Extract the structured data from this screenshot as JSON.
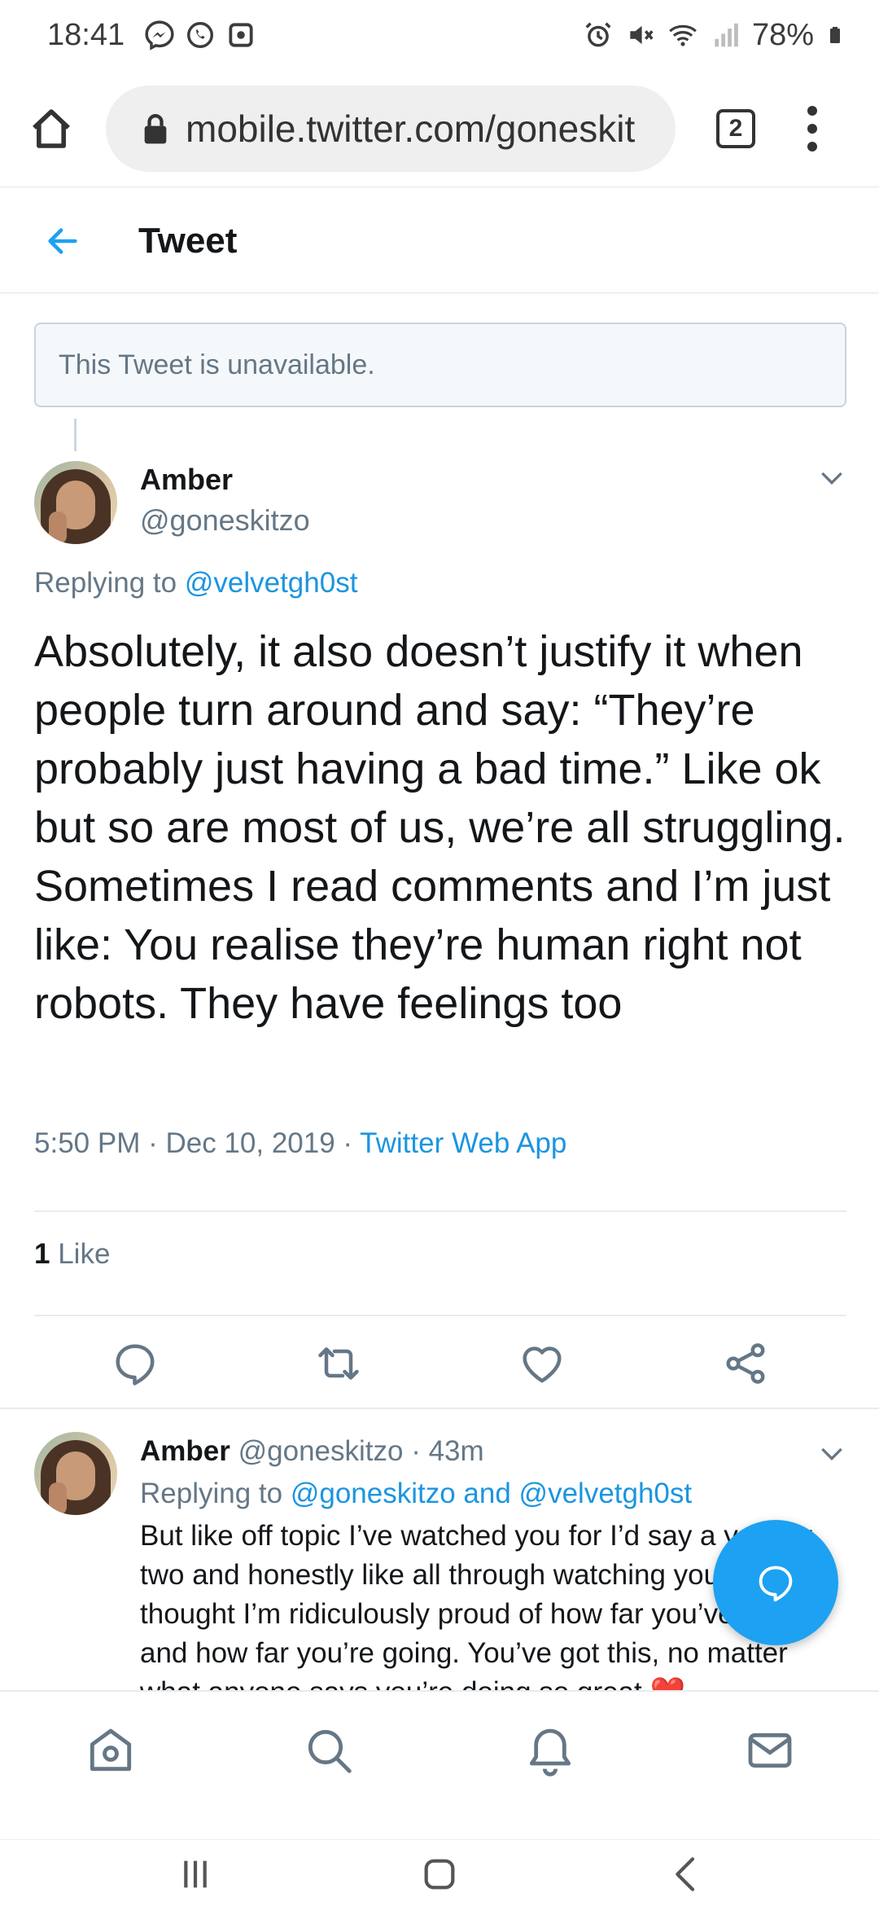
{
  "status_bar": {
    "time": "18:41",
    "left_icons": [
      "messenger-icon",
      "whatsapp-icon",
      "screenshot-icon"
    ],
    "right_icons": [
      "alarm-icon",
      "mute-icon",
      "wifi-icon",
      "signal-icon"
    ],
    "battery": "78%"
  },
  "browser": {
    "url": "mobile.twitter.com/goneskit",
    "tab_count": "2"
  },
  "header": {
    "title": "Tweet"
  },
  "unavailable_notice": "This Tweet is unavailable.",
  "tweet": {
    "name": "Amber",
    "handle": "@goneskitzo",
    "replying_prefix": "Replying to",
    "replying_to": "@velvetgh0st",
    "text": "Absolutely, it also doesn’t justify it when people turn around and say: “They’re probably just having a bad time.” Like ok but so are most of us, we’re all struggling. Sometimes I read comments and I’m just like: You realise they’re human right not robots. They have feelings too",
    "time": "5:50 PM",
    "date": "Dec 10, 2019",
    "source": "Twitter Web App",
    "like_count": "1",
    "like_label": "Like"
  },
  "reply": {
    "name": "Amber",
    "handle": "@goneskitzo",
    "age": "43m",
    "replying_prefix": "Replying to",
    "replying_to": "@goneskitzo and @velvetgh0st",
    "text": "But like off topic I’ve watched you for I’d say a year or two and honestly like all through watching you I’ve just thought I’m ridiculously proud of how far you’ve come and how far you’re going. You’ve got this, no matter what anyone says you’re doing so great ❤️"
  },
  "colors": {
    "accent": "#1da1f2",
    "link": "#1b95e0",
    "muted": "#657786",
    "text": "#14171a"
  },
  "nav": [
    "home-icon",
    "search-icon",
    "notifications-icon",
    "messages-icon"
  ]
}
